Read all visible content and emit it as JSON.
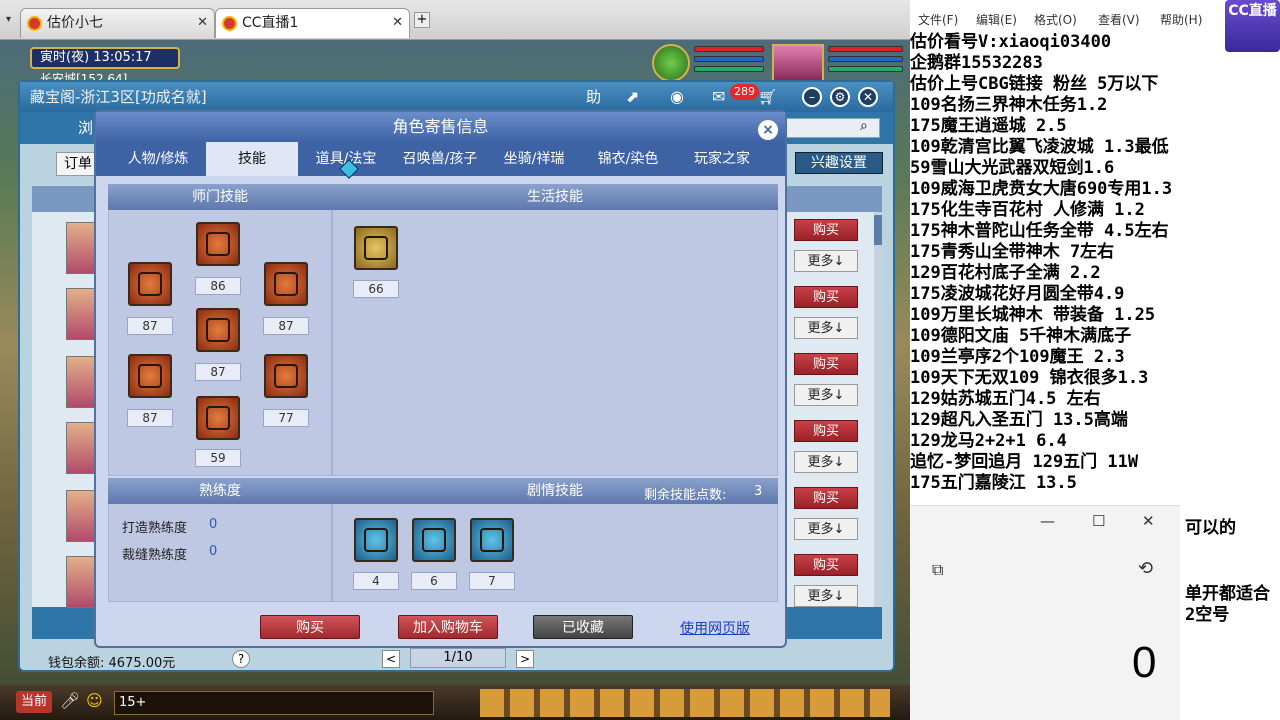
{
  "browser": {
    "tabs": [
      {
        "label": "估价小七"
      },
      {
        "label": "CC直播1"
      }
    ],
    "new_tab": "+"
  },
  "game": {
    "clock": "寅时(夜)  13:05:17",
    "location_partial": "长安城[152,64]"
  },
  "shop": {
    "title": "藏宝阁-浙江3区[功成名就]",
    "title_icons": {
      "help": "助",
      "chat_badge": "289"
    },
    "search_partial": "浏",
    "order_partial": "订单",
    "interest_button": "兴趣设置",
    "wallet_label": "钱包余额: 4675.00元",
    "help_q": "?",
    "page_indicator": "1/10",
    "prev": "<",
    "next": ">",
    "side_actions": [
      {
        "buy": "购买",
        "more": "更多↓"
      },
      {
        "buy": "购买",
        "more": "更多↓"
      },
      {
        "buy": "购买",
        "more": "更多↓"
      },
      {
        "buy": "购买",
        "more": "更多↓"
      },
      {
        "buy": "购买",
        "more": "更多↓"
      },
      {
        "buy": "购买",
        "more": "更多↓"
      }
    ]
  },
  "dialog": {
    "title": "角色寄售信息",
    "close": "×",
    "tabs": [
      "人物/修炼",
      "技能",
      "道具/法宝",
      "召唤兽/孩子",
      "坐骑/祥瑞",
      "锦衣/染色",
      "玩家之家"
    ],
    "active_tab": "技能",
    "school_skills_title": "师门技能",
    "school_skills": [
      "87",
      "86",
      "87",
      "87",
      "87",
      "77",
      "59"
    ],
    "life_skills_title": "生活技能",
    "life_skills": [
      "66"
    ],
    "proficiency_title": "熟练度",
    "proficiency": [
      {
        "label": "打造熟练度",
        "value": "0"
      },
      {
        "label": "裁缝熟练度",
        "value": "0"
      }
    ],
    "story_skills_title": "剧情技能",
    "remaining_points_label": "剩余技能点数:",
    "remaining_points": "3",
    "story_skills": [
      "4",
      "6",
      "7"
    ],
    "buttons": {
      "buy": "购买",
      "add_cart": "加入购物车",
      "collected": "已收藏",
      "web_version": "使用网页版"
    }
  },
  "notepad": {
    "menu": [
      "文件(F)",
      "编辑(E)",
      "格式(O)",
      "查看(V)",
      "帮助(H)"
    ],
    "lines": [
      "估价看号V:xiaoqi03400",
      "企鹅群15532283",
      "估价上号CBG链接  粉丝  5万以下",
      "109名扬三界神木任务1.2",
      "175魔王逍遥城 2.5",
      "109乾清宫比翼飞凌波城 1.3最低",
      "59雪山大光武器双短剑1.6",
      "109威海卫虎贲女大唐690专用1.3",
      "175化生寺百花村 人修满 1.2",
      "175神木普陀山任务全带 4.5左右",
      "175青秀山全带神木  7左右",
      "129百花村底子全满 2.2",
      "175凌波城花好月圆全带4.9",
      "109万里长城神木 带装备  1.25",
      "109德阳文庙 5千神木满底子",
      "109兰亭序2个109魔王 2.3",
      "109天下无双109  锦衣很多1.3",
      "129姑苏城五门4.5 左右",
      "129超凡入圣五门  13.5高端",
      "129龙马2+2+1  6.4",
      "追忆-梦回追月 129五门 11W",
      "175五门嘉陵江 13.5"
    ],
    "partial_lines": [
      "可以的",
      "单开都适合",
      "2空号"
    ]
  },
  "cc_logo": "CC直播",
  "calculator": {
    "display": "0"
  },
  "bottom": {
    "current": "当前",
    "input_hint": "15+"
  }
}
